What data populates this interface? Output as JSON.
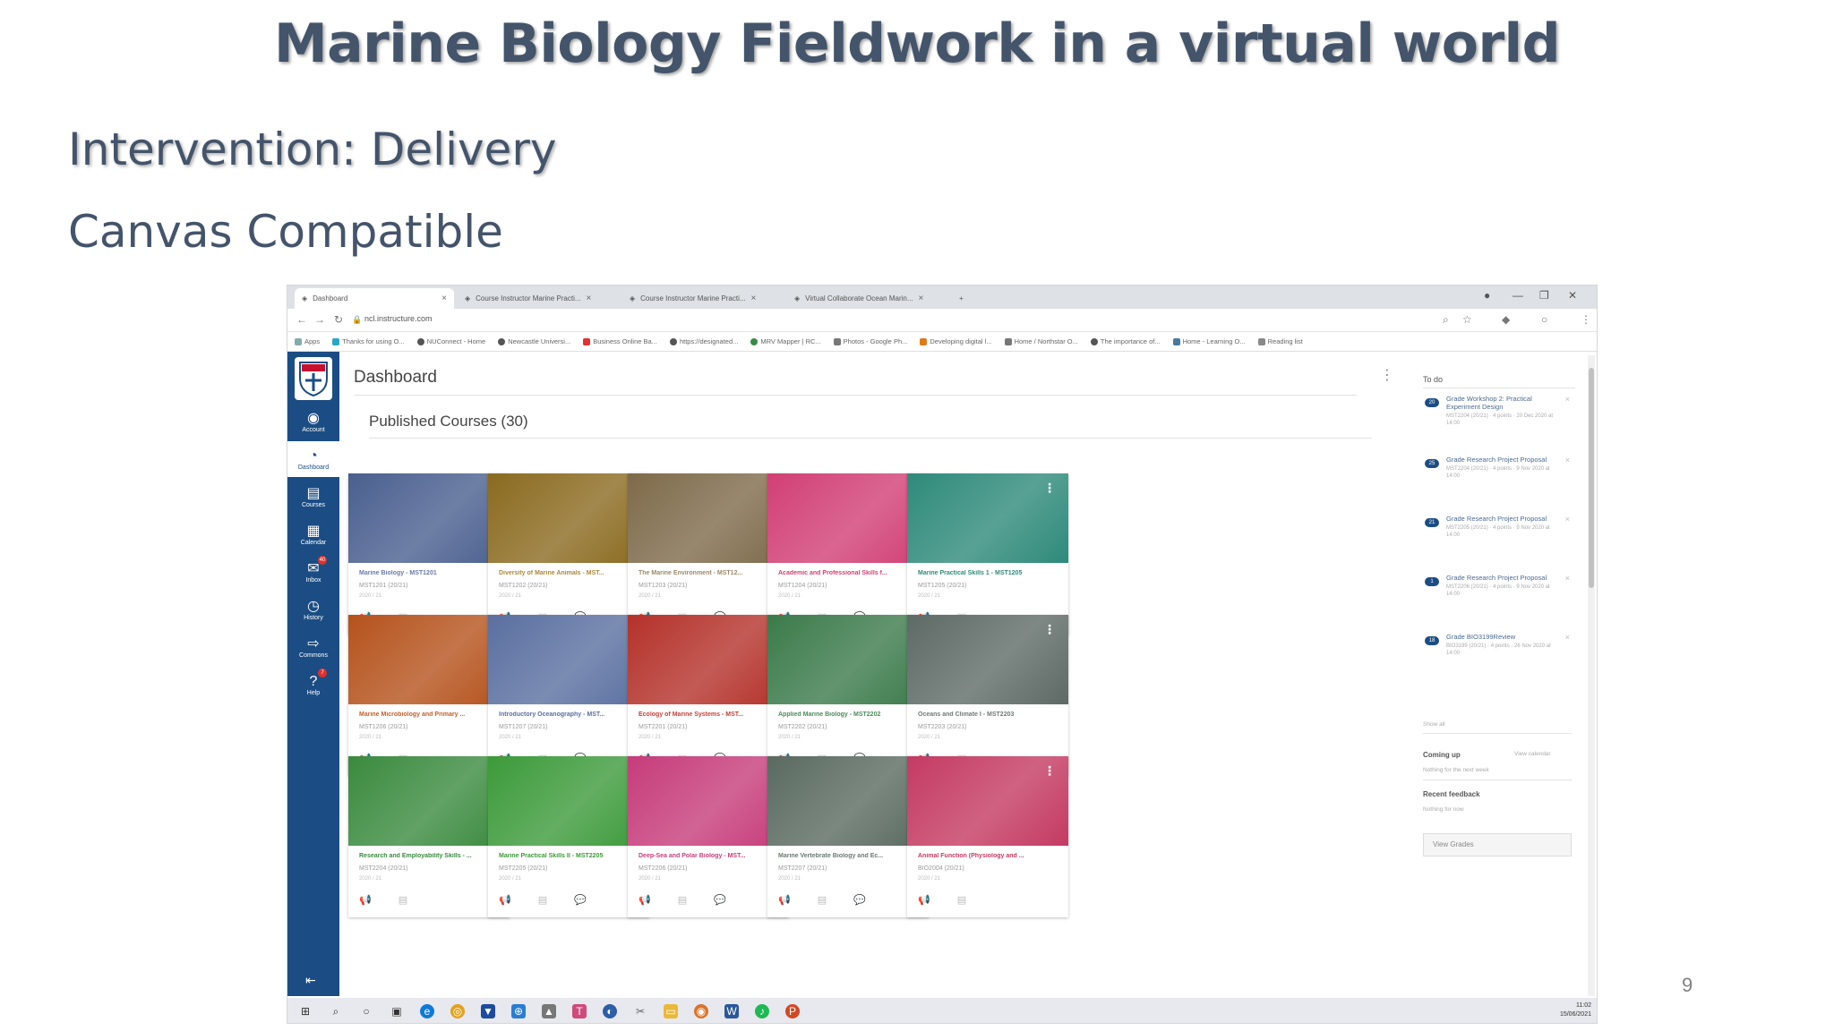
{
  "slide": {
    "title": "Marine Biology Fieldwork in a virtual world",
    "heading": "Intervention: Delivery",
    "subheading": "Canvas Compatible",
    "page_number": "9"
  },
  "browser": {
    "tabs": [
      {
        "label": "Dashboard"
      },
      {
        "label": "Course Instructor Marine Practi..."
      },
      {
        "label": "Course Instructor Marine Practi..."
      },
      {
        "label": "Virtual Collaborate Ocean Marin..."
      }
    ],
    "url": "ncl.instructure.com",
    "bookmarks": [
      "Apps",
      "Thanks for using O...",
      "NUConnect - Home",
      "Newcastle Universi...",
      "Business Online Ba...",
      "https://designated...",
      "MRV Mapper | RC...",
      "Photos - Google Ph...",
      "Developing digital l...",
      "Home / Northstar O...",
      "The importance of...",
      "Home - Learning O...",
      "Reading list"
    ]
  },
  "global_nav": {
    "items": [
      {
        "label": "Account",
        "icon": "account-icon"
      },
      {
        "label": "Dashboard",
        "icon": "dashboard-icon"
      },
      {
        "label": "Courses",
        "icon": "courses-icon"
      },
      {
        "label": "Calendar",
        "icon": "calendar-icon"
      },
      {
        "label": "Inbox",
        "icon": "inbox-icon",
        "badge": "40"
      },
      {
        "label": "History",
        "icon": "history-icon"
      },
      {
        "label": "Commons",
        "icon": "commons-icon"
      },
      {
        "label": "Help",
        "icon": "help-icon",
        "badge": "7"
      }
    ]
  },
  "dashboard": {
    "title": "Dashboard",
    "section_title": "Published Courses (30)",
    "cards": [
      {
        "name": "Marine Biology - MST1201",
        "code": "MST1201 (20/21)",
        "term": "2020 / 21",
        "color": "#4a5f8f",
        "label_color": "#6a7aa8"
      },
      {
        "name": "Diversity of Marine Animals - MST...",
        "code": "MST1202 (20/21)",
        "term": "2020 / 21",
        "color": "#8a6a1f",
        "label_color": "#a88a3a"
      },
      {
        "name": "The Marine Environment - MST12...",
        "code": "MST1203 (20/21)",
        "term": "2020 / 21",
        "color": "#7e6a4a",
        "label_color": "#9a8a6a"
      },
      {
        "name": "Academic and Professional Skills f...",
        "code": "MST1204 (20/21)",
        "term": "2020 / 21",
        "color": "#d13f74",
        "label_color": "#d13f74"
      },
      {
        "name": "Marine Practical Skills 1 - MST1205",
        "code": "MST1205 (20/21)",
        "term": "2020 / 21",
        "color": "#2e8a7a",
        "label_color": "#2e8a7a"
      },
      {
        "name": "Marine Microbiology and Primary ...",
        "code": "MST1206 (20/21)",
        "term": "2020 / 21",
        "color": "#b5521c",
        "label_color": "#c0602a"
      },
      {
        "name": "Introductory Oceanography - MST...",
        "code": "MST1207 (20/21)",
        "term": "2020 / 21",
        "color": "#5a6fa0",
        "label_color": "#5a6fa0"
      },
      {
        "name": "Ecology of Marine Systems - MST...",
        "code": "MST2201 (20/21)",
        "term": "2020 / 21",
        "color": "#b4312a",
        "label_color": "#c2403a"
      },
      {
        "name": "Applied Marine Biology - MST2202",
        "code": "MST2202 (20/21)",
        "term": "2020 / 21",
        "color": "#3b7a4a",
        "label_color": "#4b8a5a"
      },
      {
        "name": "Oceans and Climate I - MST2203",
        "code": "MST2203 (20/21)",
        "term": "2020 / 21",
        "color": "#5e6a66",
        "label_color": "#6e7a76"
      },
      {
        "name": "Research and Employability Skills - ...",
        "code": "MST2204 (20/21)",
        "term": "2020 / 21",
        "color": "#3a8a3e",
        "label_color": "#3a8a3e"
      },
      {
        "name": "Marine Practical Skills II - MST2205",
        "code": "MST2205 (20/21)",
        "term": "2020 / 21",
        "color": "#3c9a3a",
        "label_color": "#3c9a3a"
      },
      {
        "name": "Deep-Sea and Polar Biology - MST...",
        "code": "MST2206 (20/21)",
        "term": "2020 / 21",
        "color": "#c63c7a",
        "label_color": "#c63c7a"
      },
      {
        "name": "Marine Vertebrate Biology and Ec...",
        "code": "MST2207 (20/21)",
        "term": "2020 / 21",
        "color": "#5a6a60",
        "label_color": "#6a7a70"
      },
      {
        "name": "Animal Function (Physiology and ...",
        "code": "BIO2004 (20/21)",
        "term": "2020 / 21",
        "color": "#c43a62",
        "label_color": "#c43a62"
      }
    ]
  },
  "todo": {
    "title": "To do",
    "items": [
      {
        "badge": "20",
        "text": "Grade Workshop 2: Practical Experiment Design",
        "meta": "MST2204 (20/21) · 4 points · 20 Dec 2020 at 14:00"
      },
      {
        "badge": "25",
        "text": "Grade Research Project Proposal",
        "meta": "MST2204 (20/21) · 4 points · 9 Nov 2020 at 14:00"
      },
      {
        "badge": "21",
        "text": "Grade Research Project Proposal",
        "meta": "MST2205 (20/21) · 4 points · 9 Nov 2020 at 14:00"
      },
      {
        "badge": "1",
        "text": "Grade Research Project Proposal",
        "meta": "MST2206 (20/21) · 4 points · 9 Nov 2020 at 14:00"
      },
      {
        "badge": "18",
        "text": "Grade BIO3199Review",
        "meta": "BIO3199 (20/21) · 4 points · 26 Nov 2020 at 14:00"
      }
    ],
    "show_all": "Show all",
    "coming_up": "Coming up",
    "view_calendar": "View calendar",
    "coming_up_empty": "Nothing for the next week",
    "recent_feedback": "Recent feedback",
    "recent_feedback_empty": "Nothing for now",
    "view_grades": "View Grades"
  },
  "taskbar": {
    "time": "11:02",
    "date": "15/06/2021"
  }
}
